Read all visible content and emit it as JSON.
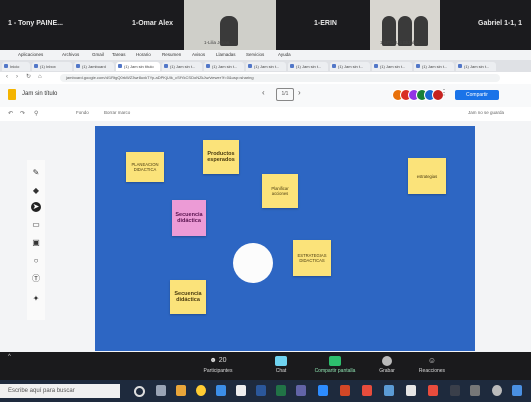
{
  "participants": [
    {
      "name": "1 - Tony PAINE...",
      "sub": ""
    },
    {
      "name": "1-Omar Alex",
      "sub": ""
    },
    {
      "name": "",
      "sub": "1-Lilia Joyan..."
    },
    {
      "name": "1-ERIN",
      "sub": ""
    },
    {
      "name": "",
      "sub": "1-EPCLUS Elizabe..."
    },
    {
      "name": "Gabriel 1-1, 1",
      "sub": ""
    }
  ],
  "browser": {
    "bookmarks": [
      "Aplicaciones",
      "Archivos",
      "Gmail",
      "Tareas",
      "Horario",
      "Resumen",
      "Avisos",
      "Llamadas",
      "Servicios",
      "Ayuda"
    ],
    "tabs": [
      "Inicio",
      "(1) Inbox",
      "(1) Jamboard",
      "(1) Jam sin título",
      "(1) Jam sin t...",
      "(1) Jam sin t...",
      "(1) Jam sin t...",
      "(1) Jam sin t...",
      "(1) Jam sin t...",
      "(1) Jam sin t...",
      "(1) Jam sin t...",
      "(1) Jam sin t..."
    ],
    "url": "jamboard.google.com/d/1RtgQ0rkWZ3wr8uxkTYp-aDPKjUIk_cSfYkCSDoNZkJw/viewer?f=0&usp=sharing"
  },
  "app": {
    "title": "Jam sin título",
    "page_indicator": "1/1",
    "share_label": "Compartir",
    "subbar": [
      "Fondo",
      "Borrar marco"
    ],
    "subbar_right": "Jam no se guarda"
  },
  "notes": [
    {
      "text": "PLANEACION DIDACTICA",
      "color": "yellow"
    },
    {
      "text": "Productos esperados",
      "color": "yellow"
    },
    {
      "text": "Planificar acciones",
      "color": "yellow"
    },
    {
      "text": "estrategias",
      "color": "yellow"
    },
    {
      "text": "Secuencia didáctica",
      "color": "pink"
    },
    {
      "text": "ESTRATEGIAS DIDACTICAS",
      "color": "yellow"
    },
    {
      "text": "Secuencia didáctica",
      "color": "yellow"
    }
  ],
  "zoom_controls": [
    {
      "label": "Participantes",
      "count": "20",
      "icon": "participants-icon"
    },
    {
      "label": "Chat",
      "icon": "chat-icon"
    },
    {
      "label": "Compartir pantalla",
      "icon": "share-screen-icon"
    },
    {
      "label": "Grabar",
      "icon": "record-icon"
    },
    {
      "label": "Reacciones",
      "icon": "reactions-icon"
    }
  ],
  "taskbar": {
    "search_placeholder": "Escribe aquí para buscar"
  },
  "colors": {
    "board": "#2d66c3",
    "sticky_yellow": "#fbe37a",
    "sticky_pink": "#ec9bd6",
    "share_button": "#1a73e8"
  }
}
